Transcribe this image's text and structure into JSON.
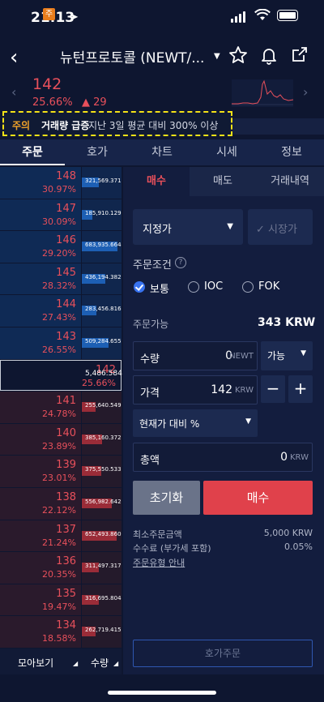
{
  "status": {
    "time": "21:13"
  },
  "header": {
    "coin_badge": "주",
    "title": "뉴턴프로토콜 (NEWT/..."
  },
  "quote": {
    "price": "142",
    "change_pct": "25.66%",
    "change_abs": "▲ 29"
  },
  "warning": {
    "tag": "주의",
    "headline": "거래량 급증",
    "detail": "지난 3일 평균 대비 300% 이상"
  },
  "tabs": [
    "주문",
    "호가",
    "차트",
    "시세",
    "정보"
  ],
  "orderbook": {
    "asks": [
      {
        "price": "148",
        "pct": "30.97%",
        "vol": "321,569.371",
        "fill": 0.45
      },
      {
        "price": "147",
        "pct": "30.09%",
        "vol": "185,910.129",
        "fill": 0.28
      },
      {
        "price": "146",
        "pct": "29.20%",
        "vol": "683,935.664",
        "fill": 0.95
      },
      {
        "price": "145",
        "pct": "28.32%",
        "vol": "436,194.382",
        "fill": 0.62
      },
      {
        "price": "144",
        "pct": "27.43%",
        "vol": "283,456.816",
        "fill": 0.4
      },
      {
        "price": "143",
        "pct": "26.55%",
        "vol": "509,284.655",
        "fill": 0.72
      }
    ],
    "current": {
      "price": "142",
      "pct": "25.66%",
      "vol": "5,486.584"
    },
    "bids": [
      {
        "price": "141",
        "pct": "24.78%",
        "vol": "255,640.549",
        "fill": 0.37
      },
      {
        "price": "140",
        "pct": "23.89%",
        "vol": "385,160.372",
        "fill": 0.55
      },
      {
        "price": "139",
        "pct": "23.01%",
        "vol": "375,550.533",
        "fill": 0.53
      },
      {
        "price": "138",
        "pct": "22.12%",
        "vol": "556,982.642",
        "fill": 0.8
      },
      {
        "price": "137",
        "pct": "21.24%",
        "vol": "652,493.860",
        "fill": 0.93
      },
      {
        "price": "136",
        "pct": "20.35%",
        "vol": "311,497.317",
        "fill": 0.45
      },
      {
        "price": "135",
        "pct": "19.47%",
        "vol": "316,695.804",
        "fill": 0.46
      },
      {
        "price": "134",
        "pct": "18.58%",
        "vol": "262,719.415",
        "fill": 0.38
      }
    ],
    "footer_left": "모아보기",
    "footer_right": "수량"
  },
  "order_tabs": [
    "매수",
    "매도",
    "거래내역"
  ],
  "order_form": {
    "order_type": "지정가",
    "market_label": "시장가",
    "conditions_label": "주문조건",
    "conditions": [
      "보통",
      "IOC",
      "FOK"
    ],
    "available_label": "주문가능",
    "available_value": "343 KRW",
    "qty_label": "수량",
    "qty_value": "0",
    "qty_unit": "NEWT",
    "qty_select": "가능",
    "price_label": "가격",
    "price_value": "142",
    "price_unit": "KRW",
    "minus": "−",
    "plus": "+",
    "pct_select": "현재가 대비 %",
    "total_label": "총액",
    "total_value": "0",
    "total_unit": "KRW",
    "reset_label": "초기화",
    "buy_label": "매수",
    "min_order_label": "최소주문금액",
    "min_order_value": "5,000 KRW",
    "fee_label": "수수료 (부가세 포함)",
    "fee_value": "0.05%",
    "guide_link": "주문유형 안내",
    "quote_order_button": "호가주문"
  }
}
